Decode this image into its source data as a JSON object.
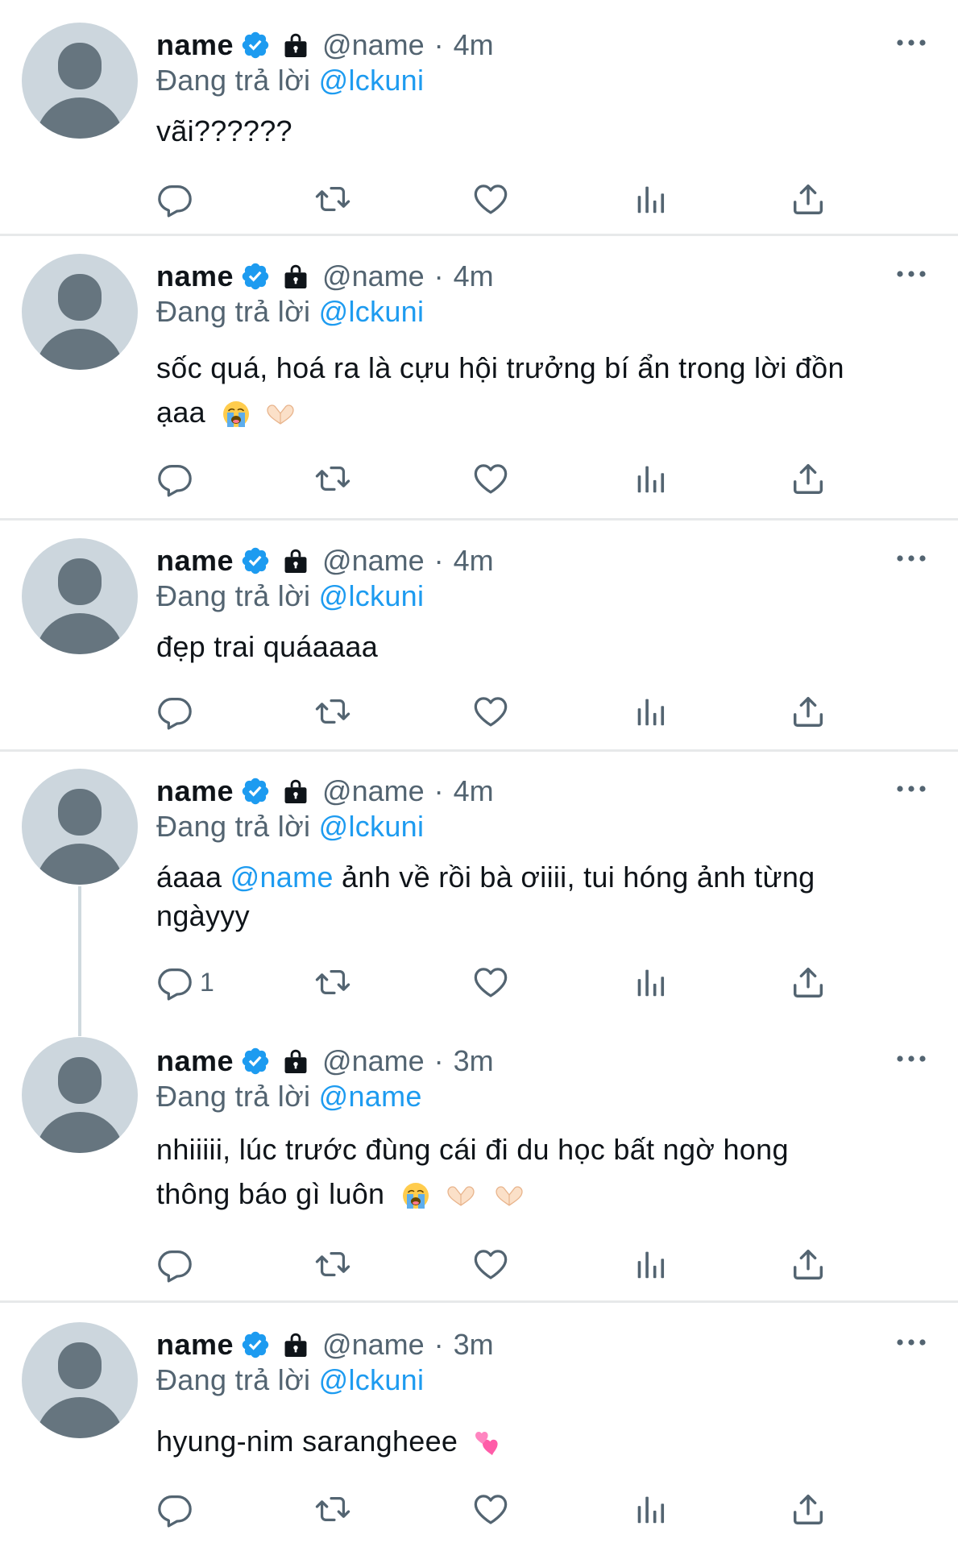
{
  "colors": {
    "accent": "#1d9bf0",
    "text": "#0f1419",
    "muted": "#536471",
    "divider": "#e7e9ea",
    "avatar_bg": "#ccd6dd",
    "avatar_fg": "#66757f"
  },
  "labels": {
    "separator": "·"
  },
  "icons": {
    "verified": "verified-badge-icon",
    "lock": "protected-lock-icon",
    "more": "more-dots-icon",
    "reply": "reply-icon",
    "retweet": "retweet-icon",
    "like": "like-heart-icon",
    "views": "views-bar-chart-icon",
    "share": "share-upload-icon"
  },
  "tweets": [
    {
      "name": "name",
      "handle": "@name",
      "time": "4m",
      "replying_prefix": "Đang trả lời",
      "replying_to": "@lckuni",
      "line1": "vãi??????",
      "reply_count": ""
    },
    {
      "name": "name",
      "handle": "@name",
      "time": "4m",
      "replying_prefix": "Đang trả lời",
      "replying_to": "@lckuni",
      "line1": "sốc quá, hoá ra là cựu hội trưởng bí ẩn trong lời đồn",
      "line2": "ạaa",
      "reply_count": ""
    },
    {
      "name": "name",
      "handle": "@name",
      "time": "4m",
      "replying_prefix": "Đang trả lời",
      "replying_to": "@lckuni",
      "line1": "đẹp trai quáaaaa",
      "reply_count": ""
    },
    {
      "name": "name",
      "handle": "@name",
      "time": "4m",
      "replying_prefix": "Đang trả lời",
      "replying_to": "@lckuni",
      "line1_a": "áaaa",
      "line1_mention": "@name",
      "line1_b": "ảnh về rồi bà ơiiii, tui hóng ảnh từng",
      "line2": "ngàyyy",
      "reply_count": "1"
    },
    {
      "name": "name",
      "handle": "@name",
      "time": "3m",
      "replying_prefix": "Đang trả lời",
      "replying_to": "@name",
      "line1": "nhiiiii, lúc trước đùng cái đi du học bất ngờ hong",
      "line2": "thông báo gì luôn",
      "reply_count": ""
    },
    {
      "name": "name",
      "handle": "@name",
      "time": "3m",
      "replying_prefix": "Đang trả lời",
      "replying_to": "@lckuni",
      "line1": "hyung-nim sarangheee",
      "reply_count": ""
    }
  ]
}
